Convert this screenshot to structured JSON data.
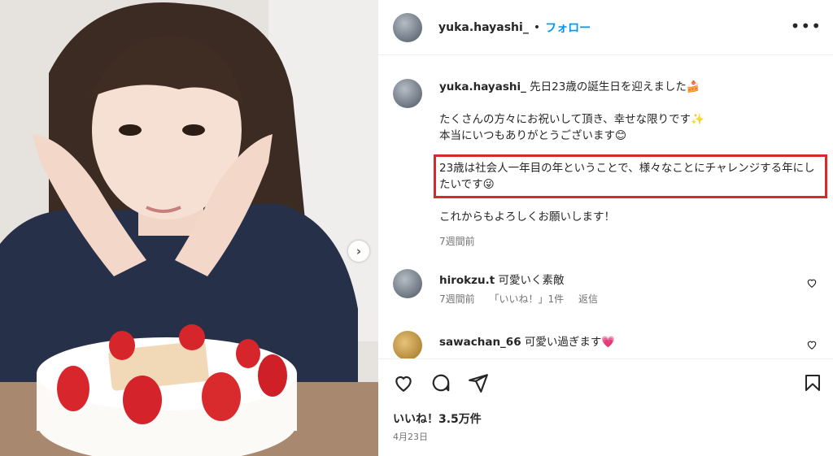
{
  "post": {
    "username": "yuka.hayashi_",
    "separator": "•",
    "follow_label": "フォロー",
    "more_icon": "more-horizontal-icon"
  },
  "caption": {
    "username": "yuka.hayashi_",
    "lines": [
      "先日23歳の誕生日を迎えました🍰",
      "たくさんの方々にお祝いして頂き、幸せな限りです✨\n本当にいつもありがとうございます😊",
      "23歳は社会人一年目の年ということで、様々なことにチャレンジする年にしたいです😜",
      "これからもよろしくお願いします！"
    ],
    "time": "7週間前"
  },
  "comments": [
    {
      "username": "hirokzu.t",
      "text": "可愛いく素敵",
      "time": "7週間前",
      "likes": "「いいね！」1件",
      "reply": "返信"
    },
    {
      "username": "sawachan_66",
      "text": "可愛い過ぎます💗",
      "time": "",
      "likes": "",
      "reply": ""
    }
  ],
  "actions": {
    "likes_label": "いいね！3.5万件",
    "date_label": "4月23日"
  },
  "colors": {
    "accent": "#0095f6",
    "highlight": "#d62b2b"
  }
}
